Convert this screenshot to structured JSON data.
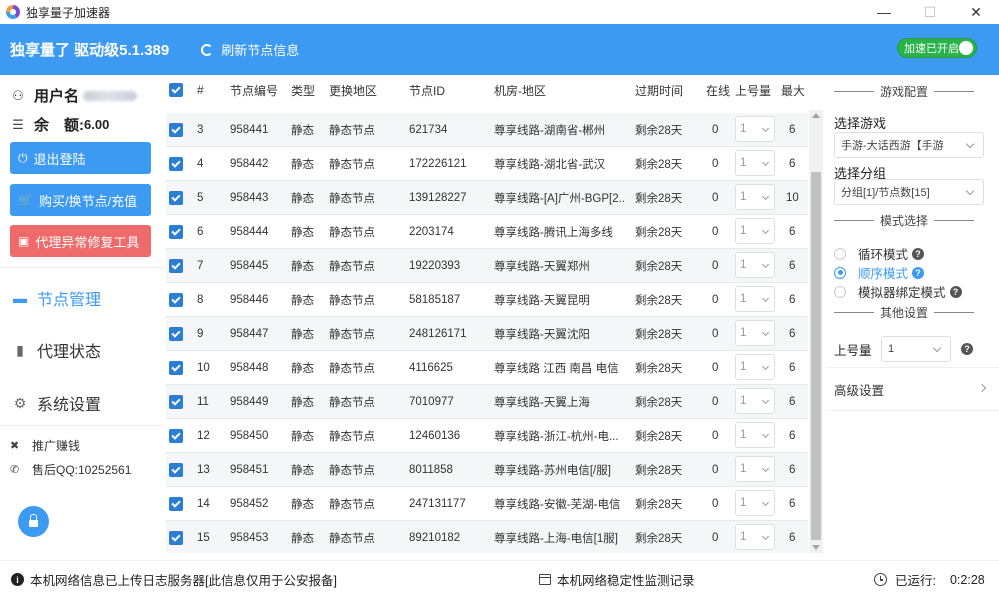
{
  "window": {
    "title": "独享量子加速器",
    "minimize": "—",
    "maximize": "☐",
    "close": "✕"
  },
  "header": {
    "title": "独享量了 驱动级5.1.389",
    "refresh_label": "刷新节点信息",
    "accel_label": "加速已开启",
    "accel_color": "#2bb34b",
    "brand_color": "#3d9af2"
  },
  "sidebar": {
    "username_label": "用户名",
    "balance_label": "余　额:",
    "balance_value": "6.00",
    "logout_label": "退出登陆",
    "buy_label": "购买/换节点/充值",
    "repair_label": "代理异常修复工具",
    "nav": [
      {
        "label": "节点管理",
        "icon": "monitor-icon"
      },
      {
        "label": "代理状态",
        "icon": "bar-chart-icon"
      },
      {
        "label": "系统设置",
        "icon": "gear-icon"
      }
    ],
    "promo_label": "推广赚钱",
    "support_label": "售后QQ:10252561"
  },
  "table": {
    "headers": [
      "#",
      "节点编号",
      "类型",
      "更换地区",
      "节点ID",
      "机房-地区",
      "过期时间",
      "在线",
      "上号量",
      "最大"
    ],
    "rows": [
      {
        "n": "3",
        "code": "958441",
        "type": "静态",
        "region": "静态节点",
        "id": "621734",
        "room": "尊享线路-湖南省-郴州",
        "expire": "剩余28天",
        "online": "0",
        "qty": "1",
        "max": "6"
      },
      {
        "n": "4",
        "code": "958442",
        "type": "静态",
        "region": "静态节点",
        "id": "172226121",
        "room": "尊享线路-湖北省-武汉",
        "expire": "剩余28天",
        "online": "0",
        "qty": "1",
        "max": "6"
      },
      {
        "n": "5",
        "code": "958443",
        "type": "静态",
        "region": "静态节点",
        "id": "139128227",
        "room": "尊享线路-[A]广州-BGP[2...",
        "expire": "剩余28天",
        "online": "0",
        "qty": "1",
        "max": "10"
      },
      {
        "n": "6",
        "code": "958444",
        "type": "静态",
        "region": "静态节点",
        "id": "2203174",
        "room": "尊享线路-腾讯上海多线",
        "expire": "剩余28天",
        "online": "0",
        "qty": "1",
        "max": "6"
      },
      {
        "n": "7",
        "code": "958445",
        "type": "静态",
        "region": "静态节点",
        "id": "19220393",
        "room": "尊享线路-天翼郑州",
        "expire": "剩余28天",
        "online": "0",
        "qty": "1",
        "max": "6"
      },
      {
        "n": "8",
        "code": "958446",
        "type": "静态",
        "region": "静态节点",
        "id": "58185187",
        "room": "尊享线路-天翼昆明",
        "expire": "剩余28天",
        "online": "0",
        "qty": "1",
        "max": "6"
      },
      {
        "n": "9",
        "code": "958447",
        "type": "静态",
        "region": "静态节点",
        "id": "248126171",
        "room": "尊享线路-天翼沈阳",
        "expire": "剩余28天",
        "online": "0",
        "qty": "1",
        "max": "6"
      },
      {
        "n": "10",
        "code": "958448",
        "type": "静态",
        "region": "静态节点",
        "id": "4116625",
        "room": "尊享线路 江西 南昌 电信",
        "expire": "剩余28天",
        "online": "0",
        "qty": "1",
        "max": "6"
      },
      {
        "n": "11",
        "code": "958449",
        "type": "静态",
        "region": "静态节点",
        "id": "7010977",
        "room": "尊享线路-天翼上海",
        "expire": "剩余28天",
        "online": "0",
        "qty": "1",
        "max": "6"
      },
      {
        "n": "12",
        "code": "958450",
        "type": "静态",
        "region": "静态节点",
        "id": "12460136",
        "room": "尊享线路-浙江-杭州-电...",
        "expire": "剩余28天",
        "online": "0",
        "qty": "1",
        "max": "6"
      },
      {
        "n": "13",
        "code": "958451",
        "type": "静态",
        "region": "静态节点",
        "id": "8011858",
        "room": "尊享线路-苏州电信[/服]",
        "expire": "剩余28天",
        "online": "0",
        "qty": "1",
        "max": "6"
      },
      {
        "n": "14",
        "code": "958452",
        "type": "静态",
        "region": "静态节点",
        "id": "247131177",
        "room": "尊享线路-安徽-芜湖-电信",
        "expire": "剩余28天",
        "online": "0",
        "qty": "1",
        "max": "6"
      },
      {
        "n": "15",
        "code": "958453",
        "type": "静态",
        "region": "静态节点",
        "id": "89210182",
        "room": "尊享线路-上海-电信[1服]",
        "expire": "剩余28天",
        "online": "0",
        "qty": "1",
        "max": "6"
      }
    ]
  },
  "right_panel": {
    "game_config_title": "游戏配置",
    "choose_game_label": "选择游戏",
    "game_value": "手游-大话西游【手游",
    "choose_group_label": "选择分组",
    "group_value": "分组[1]/节点数[15]",
    "mode_title": "模式选择",
    "modes": [
      {
        "label": "循环模式",
        "selected": false
      },
      {
        "label": "顺序模式",
        "selected": true
      },
      {
        "label": "模拟器绑定模式",
        "selected": false
      }
    ],
    "other_title": "其他设置",
    "account_qty_label": "上号量",
    "account_qty_value": "1",
    "advanced_label": "高级设置"
  },
  "status": {
    "notice": "本机网络信息已上传日志服务器[此信息仅用于公安报备]",
    "monitor": "本机网络稳定性监测记录",
    "runtime_label": "已运行:",
    "runtime_value": "0:2:28"
  }
}
